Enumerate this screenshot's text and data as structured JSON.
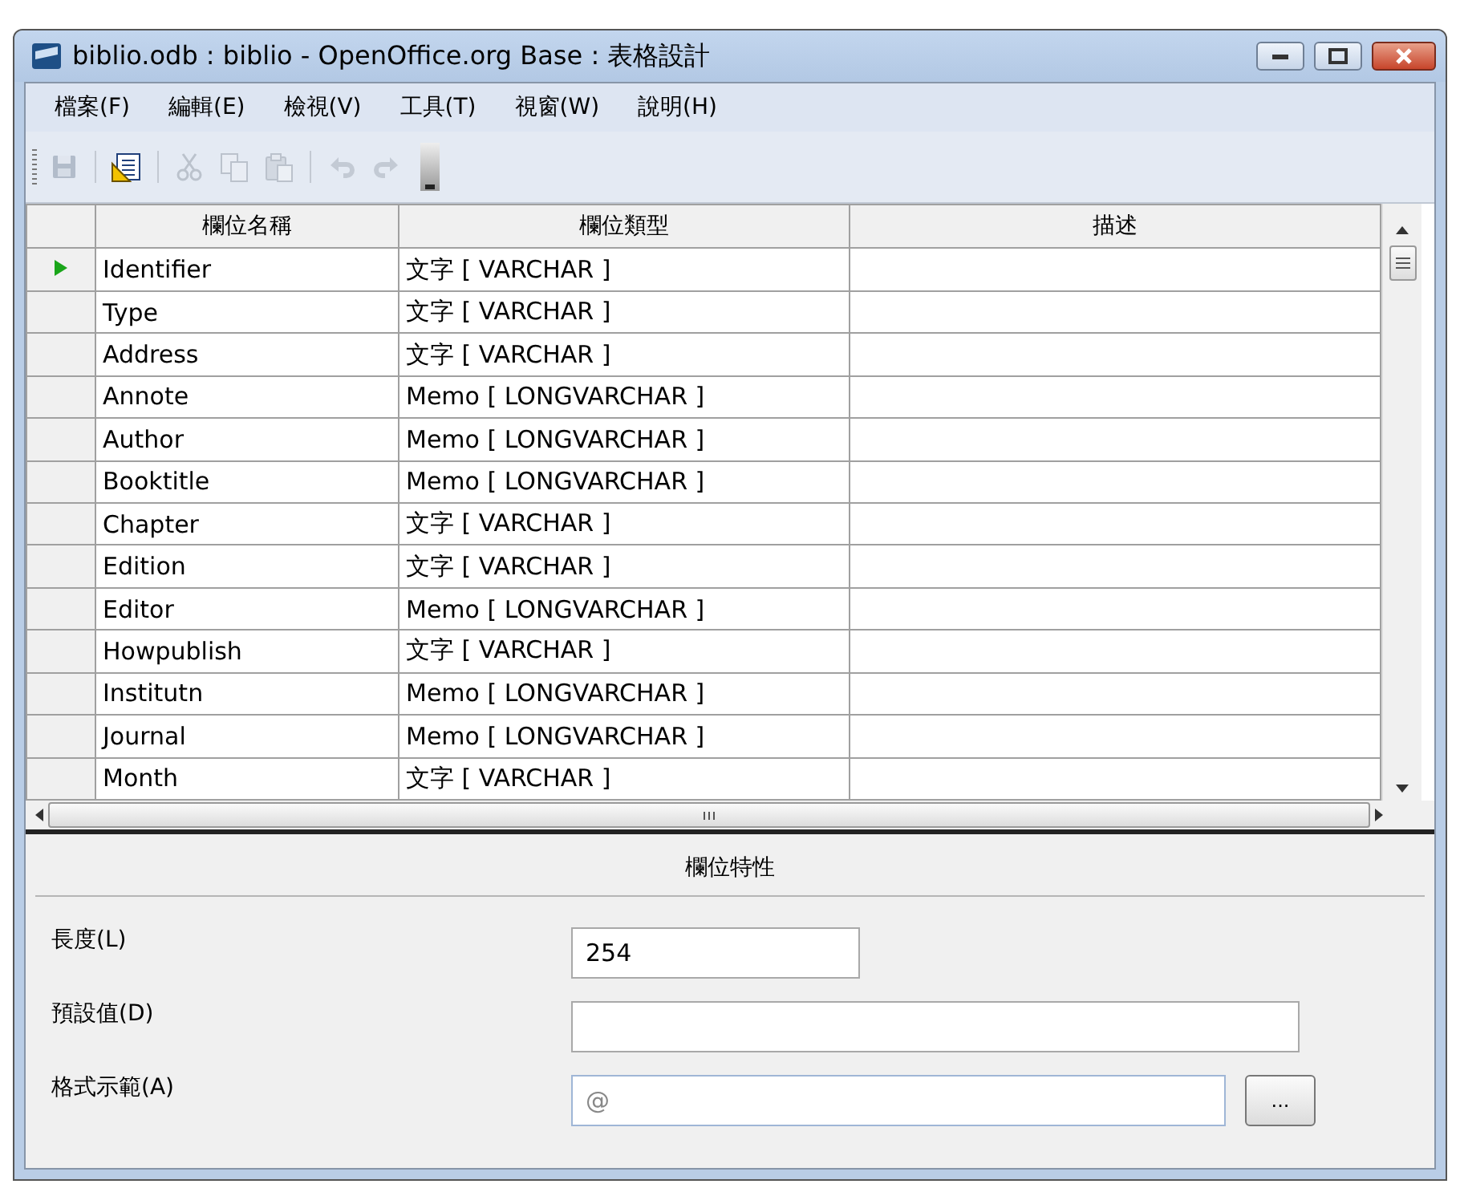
{
  "window": {
    "title": "biblio.odb : biblio - OpenOffice.org Base : 表格設計"
  },
  "menu": [
    "檔案(F)",
    "編輯(E)",
    "檢視(V)",
    "工具(T)",
    "視窗(W)",
    "說明(H)"
  ],
  "toolbar": [
    {
      "kind": "save",
      "disabled": true
    },
    {
      "kind": "sep"
    },
    {
      "kind": "design",
      "disabled": false
    },
    {
      "kind": "sep"
    },
    {
      "kind": "cut",
      "disabled": true
    },
    {
      "kind": "copy",
      "disabled": true
    },
    {
      "kind": "paste",
      "disabled": true
    },
    {
      "kind": "sep"
    },
    {
      "kind": "undo",
      "disabled": true
    },
    {
      "kind": "redo",
      "disabled": true
    }
  ],
  "table": {
    "columns": [
      "欄位名稱",
      "欄位類型",
      "描述"
    ],
    "rows": [
      {
        "name": "Identifier",
        "type": "文字 [ VARCHAR ]",
        "selected": true
      },
      {
        "name": "Type",
        "type": "文字 [ VARCHAR ]",
        "selected": false
      },
      {
        "name": "Address",
        "type": "文字 [ VARCHAR ]",
        "selected": false
      },
      {
        "name": "Annote",
        "type": "Memo [ LONGVARCHAR ]",
        "selected": false
      },
      {
        "name": "Author",
        "type": "Memo [ LONGVARCHAR ]",
        "selected": false
      },
      {
        "name": "Booktitle",
        "type": "Memo [ LONGVARCHAR ]",
        "selected": false
      },
      {
        "name": "Chapter",
        "type": "文字 [ VARCHAR ]",
        "selected": false
      },
      {
        "name": "Edition",
        "type": "文字 [ VARCHAR ]",
        "selected": false
      },
      {
        "name": "Editor",
        "type": "Memo [ LONGVARCHAR ]",
        "selected": false
      },
      {
        "name": "Howpublish",
        "type": "文字 [ VARCHAR ]",
        "selected": false
      },
      {
        "name": "Institutn",
        "type": "Memo [ LONGVARCHAR ]",
        "selected": false
      },
      {
        "name": "Journal",
        "type": "Memo [ LONGVARCHAR ]",
        "selected": false
      },
      {
        "name": "Month",
        "type": "文字 [ VARCHAR ]",
        "selected": false
      }
    ]
  },
  "properties": {
    "title": "欄位特性",
    "fields": [
      {
        "label": "長度(L)",
        "value": "254",
        "kind": "short",
        "disabled": false
      },
      {
        "label": "預設值(D)",
        "kind": "long",
        "disabled": false
      },
      {
        "label": "格式示範(A)",
        "value": "@",
        "kind": "format",
        "disabled": true,
        "button": "..."
      }
    ]
  }
}
